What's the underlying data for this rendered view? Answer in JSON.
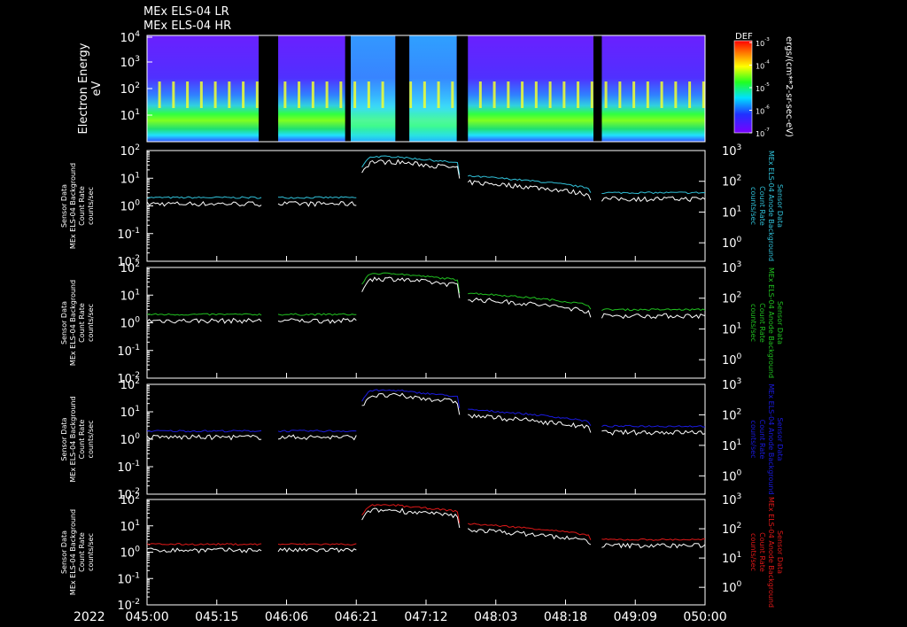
{
  "header": {
    "line1": "MEx ELS-04 LR",
    "line2": "MEx ELS-04 HR"
  },
  "year": "2022",
  "chart_data": [
    {
      "type": "heatmap",
      "ylabel": "Electron Energy",
      "yunit": "eV",
      "ylim": [
        1,
        10000
      ],
      "yscale": "log",
      "colorbar": {
        "title": "DEF",
        "unit": "ergs/(cm**2-sr-sec-eV)",
        "range": [
          1e-07,
          0.001
        ],
        "ticks": [
          {
            "exp": "-3"
          },
          {
            "exp": "-4"
          },
          {
            "exp": "-5"
          },
          {
            "exp": "-6"
          },
          {
            "exp": "-7"
          }
        ]
      },
      "gaps": [
        [
          0.2,
          0.235
        ],
        [
          0.355,
          0.365
        ],
        [
          0.445,
          0.47
        ],
        [
          0.555,
          0.575
        ],
        [
          0.8,
          0.815
        ]
      ]
    },
    {
      "type": "line",
      "ylabel_left": [
        "Sensor Data",
        "MEx ELS-04 Background",
        "Count Rate",
        "counts/sec"
      ],
      "ylabel_right": [
        "Sensor Data",
        "MEx ELS-04 Anode Background",
        "Count Rate",
        "counts/sec"
      ],
      "ylim_left": [
        0.01,
        100
      ],
      "ylim_right": [
        1,
        1000
      ],
      "series": [
        {
          "color": "#30c0d8"
        },
        {
          "color": "#ffffff"
        }
      ]
    },
    {
      "type": "line",
      "ylabel_left": [
        "Sensor Data",
        "MEx ELS-04 Background",
        "Count Rate",
        "counts/sec"
      ],
      "ylabel_right": [
        "Sensor Data",
        "MEx ELS-04 Anode Background",
        "Count Rate",
        "counts/sec"
      ],
      "ylim_left": [
        0.01,
        100
      ],
      "ylim_right": [
        1,
        1000
      ],
      "series": [
        {
          "color": "#20c020"
        },
        {
          "color": "#ffffff"
        }
      ]
    },
    {
      "type": "line",
      "ylabel_left": [
        "Sensor Data",
        "MEx ELS-04 Background",
        "Count Rate",
        "counts/sec"
      ],
      "ylabel_right": [
        "Sensor Data",
        "MEx ELS-04 Anode Background",
        "Count Rate",
        "counts/sec"
      ],
      "ylim_left": [
        0.01,
        100
      ],
      "ylim_right": [
        1,
        1000
      ],
      "series": [
        {
          "color": "#1a1ae0"
        },
        {
          "color": "#ffffff"
        }
      ]
    },
    {
      "type": "line",
      "ylabel_left": [
        "Sensor Data",
        "MEx ELS-04 Background",
        "Count Rate",
        "counts/sec"
      ],
      "ylabel_right": [
        "Sensor Data",
        "MEx ELS-04 Anode Background",
        "Count Rate",
        "counts/sec"
      ],
      "ylim_left": [
        0.01,
        100
      ],
      "ylim_right": [
        1,
        1000
      ],
      "series": [
        {
          "color": "#e01818"
        },
        {
          "color": "#ffffff"
        }
      ]
    }
  ],
  "x_axis": {
    "ticks": [
      "045:00",
      "045:15",
      "046:06",
      "046:21",
      "047:12",
      "048:03",
      "048:18",
      "049:09",
      "050:00"
    ],
    "data_gaps": [
      [
        0.205,
        0.235
      ],
      [
        0.375,
        0.385
      ],
      [
        0.56,
        0.575
      ],
      [
        0.795,
        0.815
      ]
    ]
  },
  "series_segments": [
    {
      "x0": 0.0,
      "x1": 0.205,
      "level": 0.2,
      "ratio": 0.6
    },
    {
      "x0": 0.235,
      "x1": 0.375,
      "level": 0.2,
      "ratio": 0.6
    },
    {
      "x0": 0.385,
      "x1": 0.56,
      "level": "enhanced",
      "ratio": 0.65
    },
    {
      "x0": 0.575,
      "x1": 0.795,
      "level": "decay",
      "ratio": 0.6
    },
    {
      "x0": 0.815,
      "x1": 1.0,
      "level": 0.3,
      "ratio": 0.6
    }
  ],
  "log_tick_labels": {
    "left": [
      {
        "base": "10",
        "exp": "2"
      },
      {
        "base": "10",
        "exp": "1"
      },
      {
        "base": "10",
        "exp": "0"
      },
      {
        "base": "10",
        "exp": "-1"
      },
      {
        "base": "10",
        "exp": "-2"
      }
    ],
    "right": [
      {
        "base": "10",
        "exp": "3"
      },
      {
        "base": "10",
        "exp": "2"
      },
      {
        "base": "10",
        "exp": "1"
      },
      {
        "base": "10",
        "exp": "0"
      }
    ],
    "spectrogram": [
      {
        "base": "10",
        "exp": "4"
      },
      {
        "base": "10",
        "exp": "3"
      },
      {
        "base": "10",
        "exp": "2"
      },
      {
        "base": "10",
        "exp": "1"
      }
    ]
  }
}
